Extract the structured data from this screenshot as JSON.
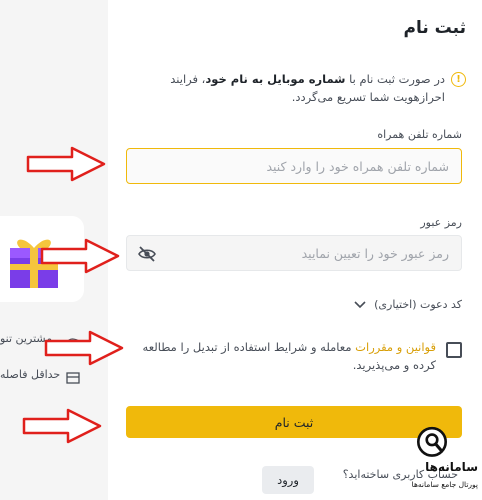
{
  "form": {
    "title": "ثبت نام",
    "notice_prefix": "در صورت ثبت نام با",
    "notice_bold": "شماره موبایل به نام خود",
    "notice_suffix": "، فرایند احرازهویت شما تسریع می‌گردد.",
    "phone_label": "شماره تلفن همراه",
    "phone_placeholder": "شماره تلفن همراه خود را وارد کنید",
    "password_label": "رمز عبور",
    "password_placeholder": "رمز عبور خود را تعیین نمایید",
    "invite_label": "کد دعوت (اختیاری)",
    "terms_link": "قوانین و مقررات",
    "terms_text": "معامله و شرایط استفاده از تبدیل را مطالعه کرده و می‌پذیرید.",
    "submit_label": "ثبت نام",
    "login_prompt": "حساب کاربری ساخته‌اید؟",
    "login_label": "ورود"
  },
  "background": {
    "item1": "مشترین تنو",
    "item2": "حداقل فاصله"
  },
  "watermark": {
    "title": "سامانه‌ها",
    "subtitle": "پورتال جامع سامانه‌ها"
  },
  "colors": {
    "accent": "#f0b90b",
    "link": "#d89e06",
    "arrow": "#e0201c"
  },
  "icons": [
    "info-icon",
    "eye-off-icon",
    "chevron-down-icon",
    "gift-icon",
    "watermark-logo-icon"
  ]
}
